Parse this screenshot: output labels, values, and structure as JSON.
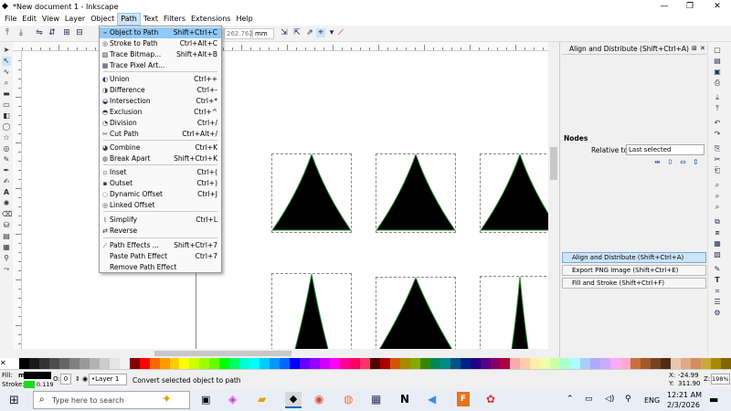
{
  "window": {
    "title": "*New document 1 - Inkscape",
    "minimize": "—",
    "maximize": "❐",
    "close": "✕"
  },
  "menubar": [
    "File",
    "Edit",
    "View",
    "Layer",
    "Object",
    "Path",
    "Text",
    "Filters",
    "Extensions",
    "Help"
  ],
  "toolbar": {
    "w_value": "262.762",
    "unit": "mm"
  },
  "path_menu": {
    "items": [
      {
        "label": "Object to Path",
        "shortcut": "Shift+Ctrl+C",
        "icon": "object-to-path-icon",
        "highlighted": true
      },
      {
        "label": "Stroke to Path",
        "shortcut": "Ctrl+Alt+C",
        "icon": "stroke-to-path-icon"
      },
      {
        "label": "Trace Bitmap...",
        "shortcut": "Shift+Alt+B",
        "icon": "trace-bitmap-icon"
      },
      {
        "label": "Trace Pixel Art...",
        "shortcut": "",
        "icon": "trace-pixel-art-icon"
      },
      {
        "label": "Union",
        "shortcut": "Ctrl++",
        "icon": "union-icon"
      },
      {
        "label": "Difference",
        "shortcut": "Ctrl+-",
        "icon": "difference-icon"
      },
      {
        "label": "Intersection",
        "shortcut": "Ctrl+*",
        "icon": "intersection-icon"
      },
      {
        "label": "Exclusion",
        "shortcut": "Ctrl+^",
        "icon": "exclusion-icon"
      },
      {
        "label": "Division",
        "shortcut": "Ctrl+/",
        "icon": "division-icon"
      },
      {
        "label": "Cut Path",
        "shortcut": "Ctrl+Alt+/",
        "icon": "cut-path-icon"
      },
      {
        "label": "Combine",
        "shortcut": "Ctrl+K",
        "icon": "combine-icon"
      },
      {
        "label": "Break Apart",
        "shortcut": "Shift+Ctrl+K",
        "icon": "break-apart-icon"
      },
      {
        "label": "Inset",
        "shortcut": "Ctrl+(",
        "icon": "inset-icon"
      },
      {
        "label": "Outset",
        "shortcut": "Ctrl+)",
        "icon": "outset-icon"
      },
      {
        "label": "Dynamic Offset",
        "shortcut": "Ctrl+J",
        "icon": "dynamic-offset-icon"
      },
      {
        "label": "Linked Offset",
        "shortcut": "",
        "icon": "linked-offset-icon"
      },
      {
        "label": "Simplify",
        "shortcut": "Ctrl+L",
        "icon": "simplify-icon"
      },
      {
        "label": "Reverse",
        "shortcut": "",
        "icon": "reverse-icon"
      },
      {
        "label": "Path Effects ...",
        "shortcut": "Shift+Ctrl+7",
        "icon": "path-effects-icon"
      },
      {
        "label": "Paste Path Effect",
        "shortcut": "Ctrl+7",
        "icon": ""
      },
      {
        "label": "Remove Path Effect",
        "shortcut": "",
        "icon": ""
      }
    ]
  },
  "dock": {
    "header": "Align and Distribute (Shift+Ctrl+A)",
    "nodes_label": "Nodes",
    "relative_to_label": "Relative to:",
    "relative_to_value": "Last selected",
    "tabs": [
      "Align and Distribute (Shift+Ctrl+A)",
      "Export PNG Image (Shift+Ctrl+E)",
      "Fill and Stroke (Shift+Ctrl+F)"
    ]
  },
  "status": {
    "fill_label": "Fill:",
    "fill_value": "m",
    "stroke_label": "Stroke:",
    "stroke_width": "0.119",
    "opacity_label": "O:",
    "opacity_value": "0",
    "layer": "•Layer 1",
    "message": "Convert selected object to path",
    "x_label": "X:",
    "x_value": "-24.99",
    "y_label": "Y:",
    "y_value": "311.90",
    "z_label": "Z:",
    "zoom": "198%"
  },
  "taskbar": {
    "search_placeholder": "Type here to search",
    "lang": "ENG",
    "time": "12:21 AM",
    "date": "2/3/2026"
  },
  "colors": {
    "accent": "#91c9f7",
    "menu_highlight": "#cce4f7",
    "shape_fill": "#000000",
    "shape_stroke": "#2e8b2e"
  }
}
